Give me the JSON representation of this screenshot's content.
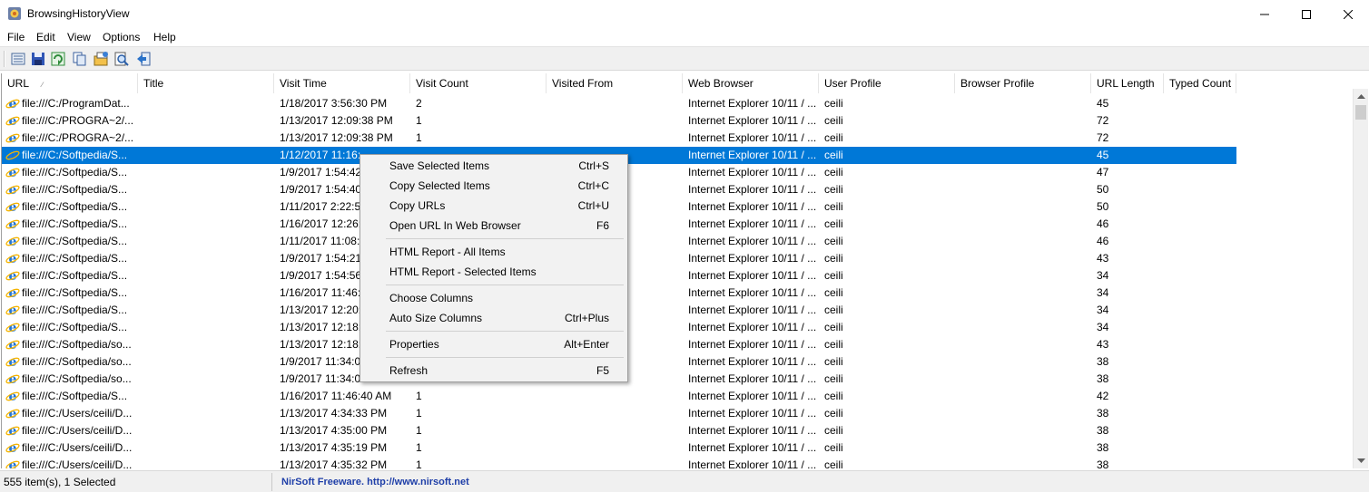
{
  "window": {
    "title": "BrowsingHistoryView"
  },
  "menu": [
    "File",
    "Edit",
    "View",
    "Options",
    "Help"
  ],
  "toolbar": [
    "properties-icon",
    "save-icon",
    "refresh-icon",
    "copy-icon",
    "html-report-icon",
    "find-icon",
    "exit-icon"
  ],
  "columns": [
    "URL",
    "Title",
    "Visit Time",
    "Visit Count",
    "Visited From",
    "Web Browser",
    "User Profile",
    "Browser Profile",
    "URL Length",
    "Typed Count"
  ],
  "rows": [
    {
      "url": "file:///C:/ProgramDat...",
      "title": "",
      "visit_time": "1/18/2017 3:56:30 PM",
      "visit_count": "2",
      "visited_from": "",
      "web_browser": "Internet Explorer 10/11 / ...",
      "user_profile": "ceili",
      "browser_profile": "",
      "url_length": "45",
      "typed_count": ""
    },
    {
      "url": "file:///C:/PROGRA~2/...",
      "title": "",
      "visit_time": "1/13/2017 12:09:38 PM",
      "visit_count": "1",
      "visited_from": "",
      "web_browser": "Internet Explorer 10/11 / ...",
      "user_profile": "ceili",
      "browser_profile": "",
      "url_length": "72",
      "typed_count": ""
    },
    {
      "url": "file:///C:/PROGRA~2/...",
      "title": "",
      "visit_time": "1/13/2017 12:09:38 PM",
      "visit_count": "1",
      "visited_from": "",
      "web_browser": "Internet Explorer 10/11 / ...",
      "user_profile": "ceili",
      "browser_profile": "",
      "url_length": "72",
      "typed_count": ""
    },
    {
      "url": "file:///C:/Softpedia/S...",
      "title": "",
      "visit_time": "1/12/2017 11:16:",
      "visit_count": "",
      "visited_from": "",
      "web_browser": "Internet Explorer 10/11 / ...",
      "user_profile": "ceili",
      "browser_profile": "",
      "url_length": "45",
      "typed_count": ""
    },
    {
      "url": "file:///C:/Softpedia/S...",
      "title": "",
      "visit_time": "1/9/2017 1:54:42",
      "visit_count": "",
      "visited_from": "",
      "web_browser": "Internet Explorer 10/11 / ...",
      "user_profile": "ceili",
      "browser_profile": "",
      "url_length": "47",
      "typed_count": ""
    },
    {
      "url": "file:///C:/Softpedia/S...",
      "title": "",
      "visit_time": "1/9/2017 1:54:40",
      "visit_count": "",
      "visited_from": "",
      "web_browser": "Internet Explorer 10/11 / ...",
      "user_profile": "ceili",
      "browser_profile": "",
      "url_length": "50",
      "typed_count": ""
    },
    {
      "url": "file:///C:/Softpedia/S...",
      "title": "",
      "visit_time": "1/11/2017 2:22:5",
      "visit_count": "",
      "visited_from": "",
      "web_browser": "Internet Explorer 10/11 / ...",
      "user_profile": "ceili",
      "browser_profile": "",
      "url_length": "50",
      "typed_count": ""
    },
    {
      "url": "file:///C:/Softpedia/S...",
      "title": "",
      "visit_time": "1/16/2017 12:26:",
      "visit_count": "",
      "visited_from": "",
      "web_browser": "Internet Explorer 10/11 / ...",
      "user_profile": "ceili",
      "browser_profile": "",
      "url_length": "46",
      "typed_count": ""
    },
    {
      "url": "file:///C:/Softpedia/S...",
      "title": "",
      "visit_time": "1/11/2017 11:08:",
      "visit_count": "",
      "visited_from": "",
      "web_browser": "Internet Explorer 10/11 / ...",
      "user_profile": "ceili",
      "browser_profile": "",
      "url_length": "46",
      "typed_count": ""
    },
    {
      "url": "file:///C:/Softpedia/S...",
      "title": "",
      "visit_time": "1/9/2017 1:54:21",
      "visit_count": "",
      "visited_from": "",
      "web_browser": "Internet Explorer 10/11 / ...",
      "user_profile": "ceili",
      "browser_profile": "",
      "url_length": "43",
      "typed_count": ""
    },
    {
      "url": "file:///C:/Softpedia/S...",
      "title": "",
      "visit_time": "1/9/2017 1:54:56",
      "visit_count": "",
      "visited_from": "",
      "web_browser": "Internet Explorer 10/11 / ...",
      "user_profile": "ceili",
      "browser_profile": "",
      "url_length": "34",
      "typed_count": ""
    },
    {
      "url": "file:///C:/Softpedia/S...",
      "title": "",
      "visit_time": "1/16/2017 11:46:",
      "visit_count": "",
      "visited_from": "",
      "web_browser": "Internet Explorer 10/11 / ...",
      "user_profile": "ceili",
      "browser_profile": "",
      "url_length": "34",
      "typed_count": ""
    },
    {
      "url": "file:///C:/Softpedia/S...",
      "title": "",
      "visit_time": "1/13/2017 12:20:",
      "visit_count": "",
      "visited_from": "",
      "web_browser": "Internet Explorer 10/11 / ...",
      "user_profile": "ceili",
      "browser_profile": "",
      "url_length": "34",
      "typed_count": ""
    },
    {
      "url": "file:///C:/Softpedia/S...",
      "title": "",
      "visit_time": "1/13/2017 12:18:",
      "visit_count": "",
      "visited_from": "",
      "web_browser": "Internet Explorer 10/11 / ...",
      "user_profile": "ceili",
      "browser_profile": "",
      "url_length": "34",
      "typed_count": ""
    },
    {
      "url": "file:///C:/Softpedia/so...",
      "title": "",
      "visit_time": "1/13/2017 12:18:",
      "visit_count": "",
      "visited_from": "",
      "web_browser": "Internet Explorer 10/11 / ...",
      "user_profile": "ceili",
      "browser_profile": "",
      "url_length": "43",
      "typed_count": ""
    },
    {
      "url": "file:///C:/Softpedia/so...",
      "title": "",
      "visit_time": "1/9/2017 11:34:0",
      "visit_count": "",
      "visited_from": "",
      "web_browser": "Internet Explorer 10/11 / ...",
      "user_profile": "ceili",
      "browser_profile": "",
      "url_length": "38",
      "typed_count": ""
    },
    {
      "url": "file:///C:/Softpedia/so...",
      "title": "",
      "visit_time": "1/9/2017 11:34:0",
      "visit_count": "",
      "visited_from": "",
      "web_browser": "Internet Explorer 10/11 / ...",
      "user_profile": "ceili",
      "browser_profile": "",
      "url_length": "38",
      "typed_count": ""
    },
    {
      "url": "file:///C:/Softpedia/S...",
      "title": "",
      "visit_time": "1/16/2017 11:46:40 AM",
      "visit_count": "1",
      "visited_from": "",
      "web_browser": "Internet Explorer 10/11 / ...",
      "user_profile": "ceili",
      "browser_profile": "",
      "url_length": "42",
      "typed_count": ""
    },
    {
      "url": "file:///C:/Users/ceili/D...",
      "title": "",
      "visit_time": "1/13/2017 4:34:33 PM",
      "visit_count": "1",
      "visited_from": "",
      "web_browser": "Internet Explorer 10/11 / ...",
      "user_profile": "ceili",
      "browser_profile": "",
      "url_length": "38",
      "typed_count": ""
    },
    {
      "url": "file:///C:/Users/ceili/D...",
      "title": "",
      "visit_time": "1/13/2017 4:35:00 PM",
      "visit_count": "1",
      "visited_from": "",
      "web_browser": "Internet Explorer 10/11 / ...",
      "user_profile": "ceili",
      "browser_profile": "",
      "url_length": "38",
      "typed_count": ""
    },
    {
      "url": "file:///C:/Users/ceili/D...",
      "title": "",
      "visit_time": "1/13/2017 4:35:19 PM",
      "visit_count": "1",
      "visited_from": "",
      "web_browser": "Internet Explorer 10/11 / ...",
      "user_profile": "ceili",
      "browser_profile": "",
      "url_length": "38",
      "typed_count": ""
    },
    {
      "url": "file:///C:/Users/ceili/D...",
      "title": "",
      "visit_time": "1/13/2017 4:35:32 PM",
      "visit_count": "1",
      "visited_from": "",
      "web_browser": "Internet Explorer 10/11 / ...",
      "user_profile": "ceili",
      "browser_profile": "",
      "url_length": "38",
      "typed_count": ""
    }
  ],
  "selected_row": 3,
  "context_menu": [
    {
      "label": "Save Selected Items",
      "shortcut": "Ctrl+S"
    },
    {
      "label": "Copy Selected Items",
      "shortcut": "Ctrl+C"
    },
    {
      "label": "Copy URLs",
      "shortcut": "Ctrl+U"
    },
    {
      "label": "Open URL In Web Browser",
      "shortcut": "F6"
    },
    {
      "separator": true
    },
    {
      "label": "HTML Report - All Items",
      "shortcut": ""
    },
    {
      "label": "HTML Report - Selected Items",
      "shortcut": ""
    },
    {
      "separator": true
    },
    {
      "label": "Choose Columns",
      "shortcut": ""
    },
    {
      "label": "Auto Size Columns",
      "shortcut": "Ctrl+Plus"
    },
    {
      "separator": true
    },
    {
      "label": "Properties",
      "shortcut": "Alt+Enter"
    },
    {
      "separator": true
    },
    {
      "label": "Refresh",
      "shortcut": "F5"
    }
  ],
  "status": {
    "items": "555 item(s), 1 Selected",
    "credit": "NirSoft Freeware.  http://www.nirsoft.net"
  },
  "colors": {
    "selection": "#0078d7",
    "credit_text": "#1f3fa8"
  }
}
